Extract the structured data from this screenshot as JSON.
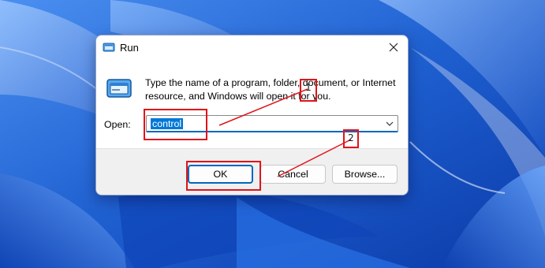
{
  "dialog": {
    "title": "Run",
    "description": "Type the name of a program, folder, document, or Internet resource, and Windows will open it for you.",
    "open_label": "Open:",
    "open_value": "control",
    "buttons": {
      "ok": "OK",
      "cancel": "Cancel",
      "browse": "Browse..."
    }
  },
  "annotations": {
    "markers": [
      "1",
      "2"
    ],
    "color": "#e0141a"
  },
  "colors": {
    "accent": "#0067c0",
    "selection": "#0078d7"
  },
  "icons": {
    "title": "run-icon",
    "main": "run-program-icon",
    "close": "close-icon",
    "dropdown": "chevron-down-icon"
  }
}
